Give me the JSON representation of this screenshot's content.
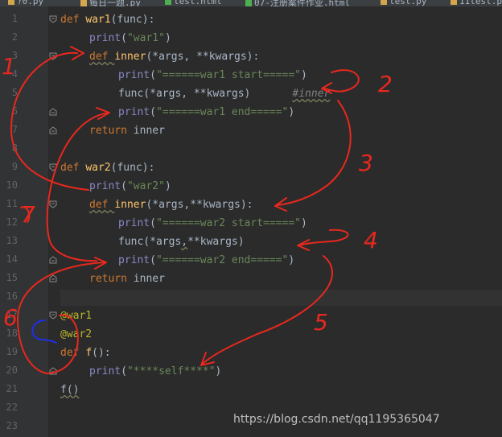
{
  "tabs": [
    {
      "label": "?0.py",
      "color": "#d4a74f"
    },
    {
      "label": "每日一题.py",
      "color": "#d4a74f"
    },
    {
      "label": "test.html",
      "color": "#4caf50"
    },
    {
      "label": "07-注册案件作业.html",
      "color": "#4caf50"
    },
    {
      "label": "test.py",
      "color": "#d4a74f"
    },
    {
      "label": "11test.p",
      "color": "#d4a74f"
    }
  ],
  "line_numbers": [
    "1",
    "2",
    "3",
    "4",
    "5",
    "6",
    "7",
    "8",
    "9",
    "10",
    "11",
    "12",
    "13",
    "14",
    "15",
    "16",
    "17",
    "18",
    "19",
    "20",
    "21",
    "22",
    "23"
  ],
  "code": {
    "l1_kw": "def ",
    "l1_name": "war1",
    "l1_rest": "(func):",
    "l2_fn": "print",
    "l2_open": "(",
    "l2_str": "\"war1\"",
    "l2_close": ")",
    "l3_kw": "def ",
    "l3_name": "inner",
    "l3_rest": "(*args, **kwargs):",
    "l4_fn": "print",
    "l4_open": "(",
    "l4_str": "\"======war1 start=====\"",
    "l4_close": ")",
    "l5_call": "func(*args, **kwargs)",
    "l5_comment": "#inner",
    "l6_fn": "print",
    "l6_open": "(",
    "l6_str": "\"======war1 end=====\"",
    "l6_close": ")",
    "l7_kw": "return ",
    "l7_val": "inner",
    "l9_kw": "def ",
    "l9_name": "war2",
    "l9_rest": "(func):",
    "l10_fn": "print",
    "l10_open": "(",
    "l10_str": "\"war2\"",
    "l10_close": ")",
    "l11_kw": "def ",
    "l11_name": "inner",
    "l11_rest": "(*args,**kwargs):",
    "l12_fn": "print",
    "l12_open": "(",
    "l12_str": "\"======war2 start=====\"",
    "l12_close": ")",
    "l13_a": "func(*args",
    "l13_b": ",",
    "l13_c": "**kwargs)",
    "l14_fn": "print",
    "l14_open": "(",
    "l14_str": "\"======war2 end=====\"",
    "l14_close": ")",
    "l15_kw": "return ",
    "l15_val": "inner",
    "l17_deco": "@war1",
    "l18_deco": "@war2",
    "l19_kw": "def ",
    "l19_name": "f",
    "l19_rest": "():",
    "l20_fn": "print",
    "l20_open": "(",
    "l20_str": "\"****self****\"",
    "l20_close": ")",
    "l21_call": "f()"
  },
  "annotations": {
    "numbers": [
      "1",
      "2",
      "3",
      "4",
      "5",
      "6",
      "7"
    ],
    "color": "#e8281e"
  },
  "watermark": "https://blog.csdn.net/qq1195365047"
}
